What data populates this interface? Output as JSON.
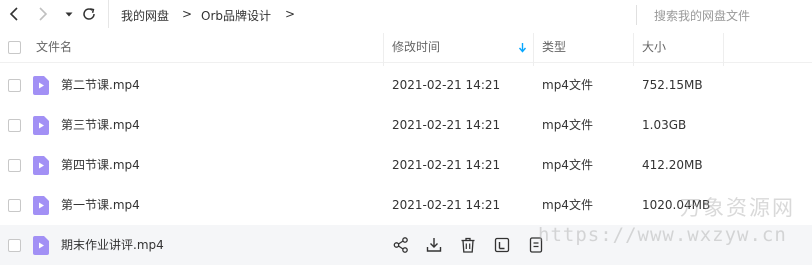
{
  "toolbar": {
    "breadcrumb": [
      "我的网盘",
      "Orb品牌设计"
    ],
    "breadcrumb_separator": ">",
    "search_placeholder": "搜索我的网盘文件"
  },
  "table": {
    "columns": {
      "name": "文件名",
      "modified": "修改时间",
      "type": "类型",
      "size": "大小"
    },
    "sort": "modified-descending",
    "rows": [
      {
        "name": "第二节课.mp4",
        "modified": "2021-02-21 14:21",
        "type": "mp4文件",
        "size": "752.15MB"
      },
      {
        "name": "第三节课.mp4",
        "modified": "2021-02-21 14:21",
        "type": "mp4文件",
        "size": "1.03GB"
      },
      {
        "name": "第四节课.mp4",
        "modified": "2021-02-21 14:21",
        "type": "mp4文件",
        "size": "412.20MB"
      },
      {
        "name": "第一节课.mp4",
        "modified": "2021-02-21 14:21",
        "type": "mp4文件",
        "size": "1020.04MB"
      }
    ],
    "hover_row": {
      "name": "期末作业讲评.mp4",
      "actions": [
        "share-icon",
        "download-icon",
        "delete-icon",
        "rename-icon",
        "more-icon"
      ]
    }
  },
  "watermark": {
    "text": "万象资源网",
    "url": "https://www.wxzyw.cn"
  },
  "colors": {
    "accent": "#06a7ff",
    "video_icon": "#a290f5",
    "hover_bg": "#f5f6f8"
  }
}
